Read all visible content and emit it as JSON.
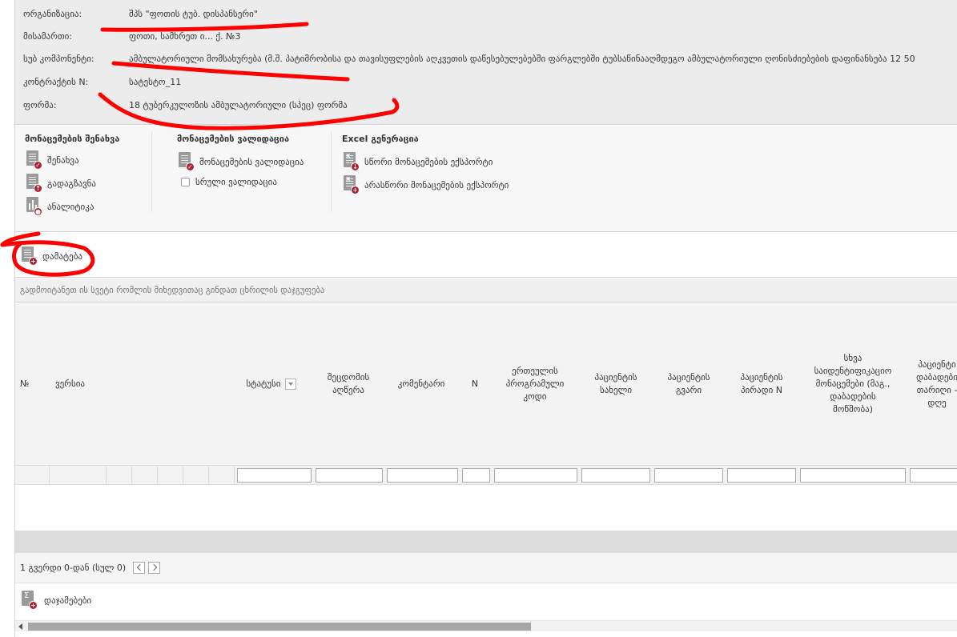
{
  "info": {
    "rows": [
      {
        "label": "ორგანიზაცია:",
        "value": "შპს \"ფოთის ტუბ. დისპანსერი\""
      },
      {
        "label": "მისამართი:",
        "value": "ფოთი, სამხრეთ ი... ქ. №3"
      },
      {
        "label": "სუბ კომპონენტი:",
        "value": "ამბულატორიული მომსახურება (მ.შ. პატიმრობისა და თავისუფლების აღკვეთის დაწესებულებებში ფარგლებში ტუბსაწინააღმდეგო ამბულატორიული ღონისძიებების დაფინანსება 12 50"
      },
      {
        "label": "კონტრაქტის N:",
        "value": "სატესტო_11"
      },
      {
        "label": "ფორმა:",
        "value": "18 ტუბერკულოზის ამბულატორიული (სპეც) ფორმა"
      }
    ]
  },
  "ribbon": {
    "save_group": {
      "title": "მონაცემების შენახვა",
      "save": "შენახვა",
      "send": "გადაგზავნა",
      "analytics": "ანალიტიკა"
    },
    "validate_group": {
      "title": "მონაცემების ვალიდაცია",
      "validate": "მონაცემების ვალიდაცია",
      "full_validation": "სრული ვალიდაცია"
    },
    "excel_group": {
      "title": "Excel გენერაცია",
      "export_correct": "სწორი მონაცემების ექსპორტი",
      "export_incorrect": "არასწორი მონაცემების ექსპორტი"
    }
  },
  "toolbar": {
    "add_label": "დამატება"
  },
  "grouping_hint": "გადმოიტანეთ ის სვეტი რომლის მიხედვითაც გინდათ ცხრილის დაჯგუფება",
  "columns": {
    "num": "№",
    "version": "ვერსია",
    "status": "სტატუსი",
    "error_l1": "შეცდომის",
    "error_l2": "აღწერა",
    "comment": "კომენტარი",
    "n": "N",
    "unified_l1": "ერთეულის",
    "unified_l2": "პროგრამული",
    "unified_l3": "კოდი",
    "pname_l1": "პაციენტის",
    "pname_l2": "სახელი",
    "psurname_l1": "პაციენტის",
    "psurname_l2": "გვარი",
    "ppersonal_l1": "პაციენტის",
    "ppersonal_l2": "პირადი N",
    "other_l1": "სხვა",
    "other_l2": "საიდენტიფიკაციო",
    "other_l3": "მონაცემები (მაგ.,",
    "other_l4": "დაბადების",
    "other_l5": "მოწმობა)",
    "birth_l1": "პაციენტი",
    "birth_l2": "დაბადები",
    "birth_l3": "თარიღი -",
    "birth_l4": "დღე"
  },
  "pager": {
    "text": "1 გვერდი 0-დან (სულ 0)"
  },
  "totals_label": "დაჯამებები",
  "colors": {
    "accent": "#b3202b",
    "annotation": "#ff0000"
  }
}
